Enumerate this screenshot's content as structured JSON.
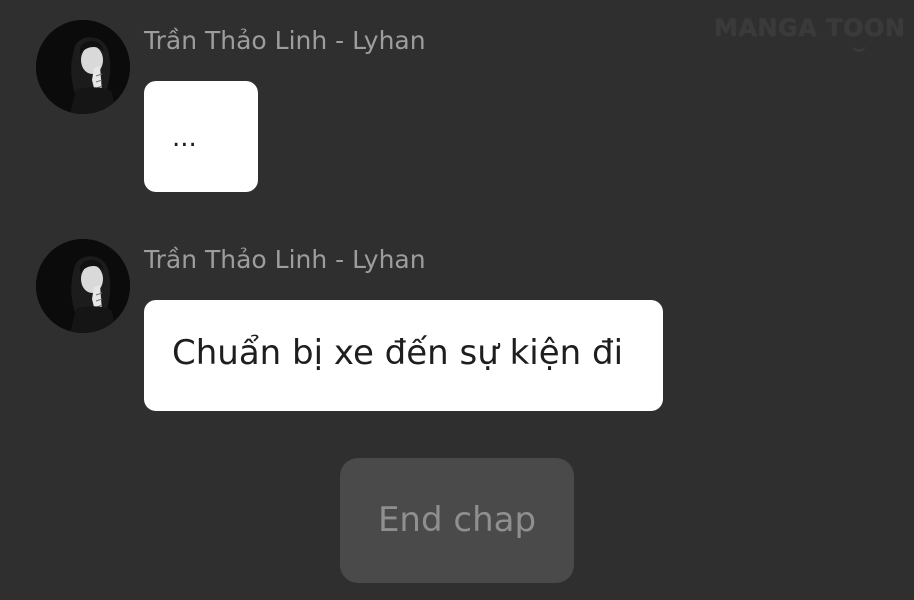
{
  "watermark": {
    "text": "MANGA TOON"
  },
  "messages": [
    {
      "sender": "Trần Thảo Linh - Lyhan",
      "text": "...",
      "avatar_icon": "profile-photo"
    },
    {
      "sender": "Trần Thảo Linh - Lyhan",
      "text": "Chuẩn bị xe đến sự kiện đi",
      "avatar_icon": "profile-photo"
    }
  ],
  "end_chap": {
    "label": "End chap"
  },
  "colors": {
    "background": "#2f2f2f",
    "bubble": "#ffffff",
    "sender_text": "#9d9d9d",
    "button_bg": "#4a4a4a",
    "button_text": "#8f8f8f"
  }
}
